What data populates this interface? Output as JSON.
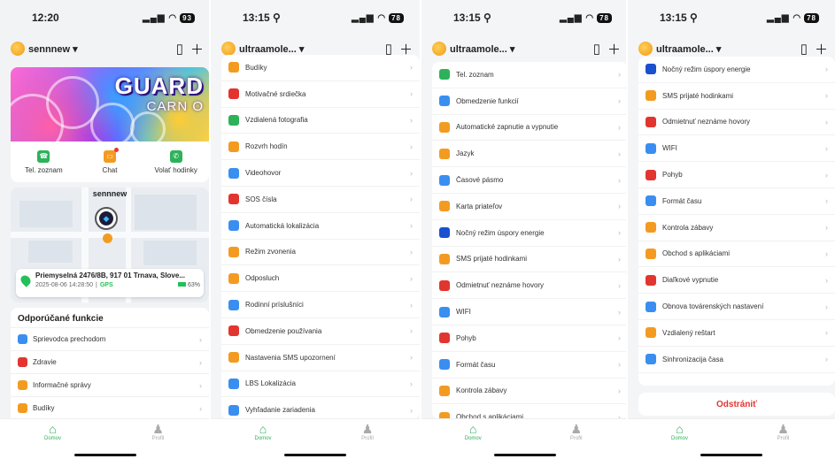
{
  "screen1": {
    "time": "12:20",
    "battery": "93",
    "account": "sennnew",
    "banner": {
      "line1": "GUARD",
      "line2": "CARN O"
    },
    "quick": [
      {
        "label": "Tel. zoznam",
        "color": "#2db25a",
        "icon": "contacts-icon"
      },
      {
        "label": "Chat",
        "color": "#f39b21",
        "icon": "chat-icon"
      },
      {
        "label": "Volať hodinky",
        "color": "#2db25a",
        "icon": "phone-icon"
      }
    ],
    "map": {
      "name": "sennnew",
      "address": "Priemyselná 2476/8B, 917 01 Trnava, Slove...",
      "datetime": "2025-08-06 14:28:50",
      "source": "GPS",
      "battery": "63%"
    },
    "features_title": "Odporúčané funkcie",
    "features": [
      {
        "label": "Sprievodca prechodom",
        "color": "#3a8ef0",
        "icon": "guide-icon"
      },
      {
        "label": "Zdravie",
        "color": "#e2352f",
        "icon": "heart-icon"
      },
      {
        "label": "Informačné správy",
        "color": "#f39b21",
        "icon": "message-icon"
      },
      {
        "label": "Budíky",
        "color": "#f39b21",
        "icon": "alarm-icon"
      }
    ]
  },
  "screen2": {
    "time": "13:15",
    "battery": "78",
    "account": "ultraamole...",
    "items": [
      {
        "label": "Budíky",
        "color": "#f39b21",
        "icon": "alarm-icon"
      },
      {
        "label": "Motivačné srdiečka",
        "color": "#e2352f",
        "icon": "heart-icon"
      },
      {
        "label": "Vzdialená fotografia",
        "color": "#2db25a",
        "icon": "camera-icon"
      },
      {
        "label": "Rozvrh hodín",
        "color": "#f39b21",
        "icon": "timetable-icon"
      },
      {
        "label": "Videohovor",
        "color": "#3a8ef0",
        "icon": "video-icon"
      },
      {
        "label": "SOS čísla",
        "color": "#e2352f",
        "icon": "sos-icon"
      },
      {
        "label": "Automatická lokalizácia",
        "color": "#3a8ef0",
        "icon": "location-icon"
      },
      {
        "label": "Režim zvonenia",
        "color": "#f39b21",
        "icon": "ring-icon"
      },
      {
        "label": "Odposluch",
        "color": "#f39b21",
        "icon": "listen-icon"
      },
      {
        "label": "Rodinní príslušníci",
        "color": "#3a8ef0",
        "icon": "family-icon"
      },
      {
        "label": "Obmedzenie používania",
        "color": "#e2352f",
        "icon": "restrict-icon"
      },
      {
        "label": "Nastavenia SMS upozornení",
        "color": "#f39b21",
        "icon": "sms-icon"
      },
      {
        "label": "LBS Lokalizácia",
        "color": "#3a8ef0",
        "icon": "lbs-icon"
      },
      {
        "label": "Vyhľadanie zariadenia",
        "color": "#3a8ef0",
        "icon": "search-icon"
      }
    ]
  },
  "screen3": {
    "time": "13:15",
    "battery": "78",
    "account": "ultraamole...",
    "items": [
      {
        "label": "Tel. zoznam",
        "color": "#2db25a",
        "icon": "contacts-icon"
      },
      {
        "label": "Obmedzenie funkcií",
        "color": "#3a8ef0",
        "icon": "limit-icon"
      },
      {
        "label": "Automatické zapnutie a vypnutie",
        "color": "#f39b21",
        "icon": "power-schedule-icon"
      },
      {
        "label": "Jazyk",
        "color": "#f39b21",
        "icon": "globe-icon"
      },
      {
        "label": "Časové pásmo",
        "color": "#3a8ef0",
        "icon": "timezone-icon"
      },
      {
        "label": "Karta priateľov",
        "color": "#f39b21",
        "icon": "friend-card-icon"
      },
      {
        "label": "Nočný režim úspory energie",
        "color": "#1a4fd0",
        "icon": "moon-icon"
      },
      {
        "label": "SMS prijaté hodinkami",
        "color": "#f39b21",
        "icon": "sms-received-icon"
      },
      {
        "label": "Odmietnuť neznáme hovory",
        "color": "#e2352f",
        "icon": "reject-call-icon"
      },
      {
        "label": "WIFI",
        "color": "#3a8ef0",
        "icon": "wifi-icon"
      },
      {
        "label": "Pohyb",
        "color": "#e2352f",
        "icon": "movement-icon"
      },
      {
        "label": "Formát času",
        "color": "#3a8ef0",
        "icon": "time-format-icon"
      },
      {
        "label": "Kontrola zábavy",
        "color": "#f39b21",
        "icon": "entertainment-icon"
      },
      {
        "label": "Obchod s aplikáciami",
        "color": "#f39b21",
        "icon": "app-store-icon"
      }
    ]
  },
  "screen4": {
    "time": "13:15",
    "battery": "78",
    "account": "ultraamole...",
    "items": [
      {
        "label": "Nočný režim úspory energie",
        "color": "#1a4fd0",
        "icon": "moon-icon"
      },
      {
        "label": "SMS prijaté hodinkami",
        "color": "#f39b21",
        "icon": "sms-received-icon"
      },
      {
        "label": "Odmietnuť neznáme hovory",
        "color": "#e2352f",
        "icon": "reject-call-icon"
      },
      {
        "label": "WIFI",
        "color": "#3a8ef0",
        "icon": "wifi-icon"
      },
      {
        "label": "Pohyb",
        "color": "#e2352f",
        "icon": "movement-icon"
      },
      {
        "label": "Formát času",
        "color": "#3a8ef0",
        "icon": "time-format-icon"
      },
      {
        "label": "Kontrola zábavy",
        "color": "#f39b21",
        "icon": "entertainment-icon"
      },
      {
        "label": "Obchod s aplikáciami",
        "color": "#f39b21",
        "icon": "app-store-icon"
      },
      {
        "label": "Diaľkové vypnutie",
        "color": "#e2352f",
        "icon": "remote-off-icon"
      },
      {
        "label": "Obnova továrenských nastavení",
        "color": "#3a8ef0",
        "icon": "factory-reset-icon"
      },
      {
        "label": "Vzdialený reštart",
        "color": "#f39b21",
        "icon": "restart-icon"
      },
      {
        "label": "Sinhronizacija časa",
        "color": "#3a8ef0",
        "icon": "sync-icon"
      }
    ],
    "delete_label": "Odstrániť"
  },
  "tabs": {
    "home": "Domov",
    "profile": "Profil"
  }
}
